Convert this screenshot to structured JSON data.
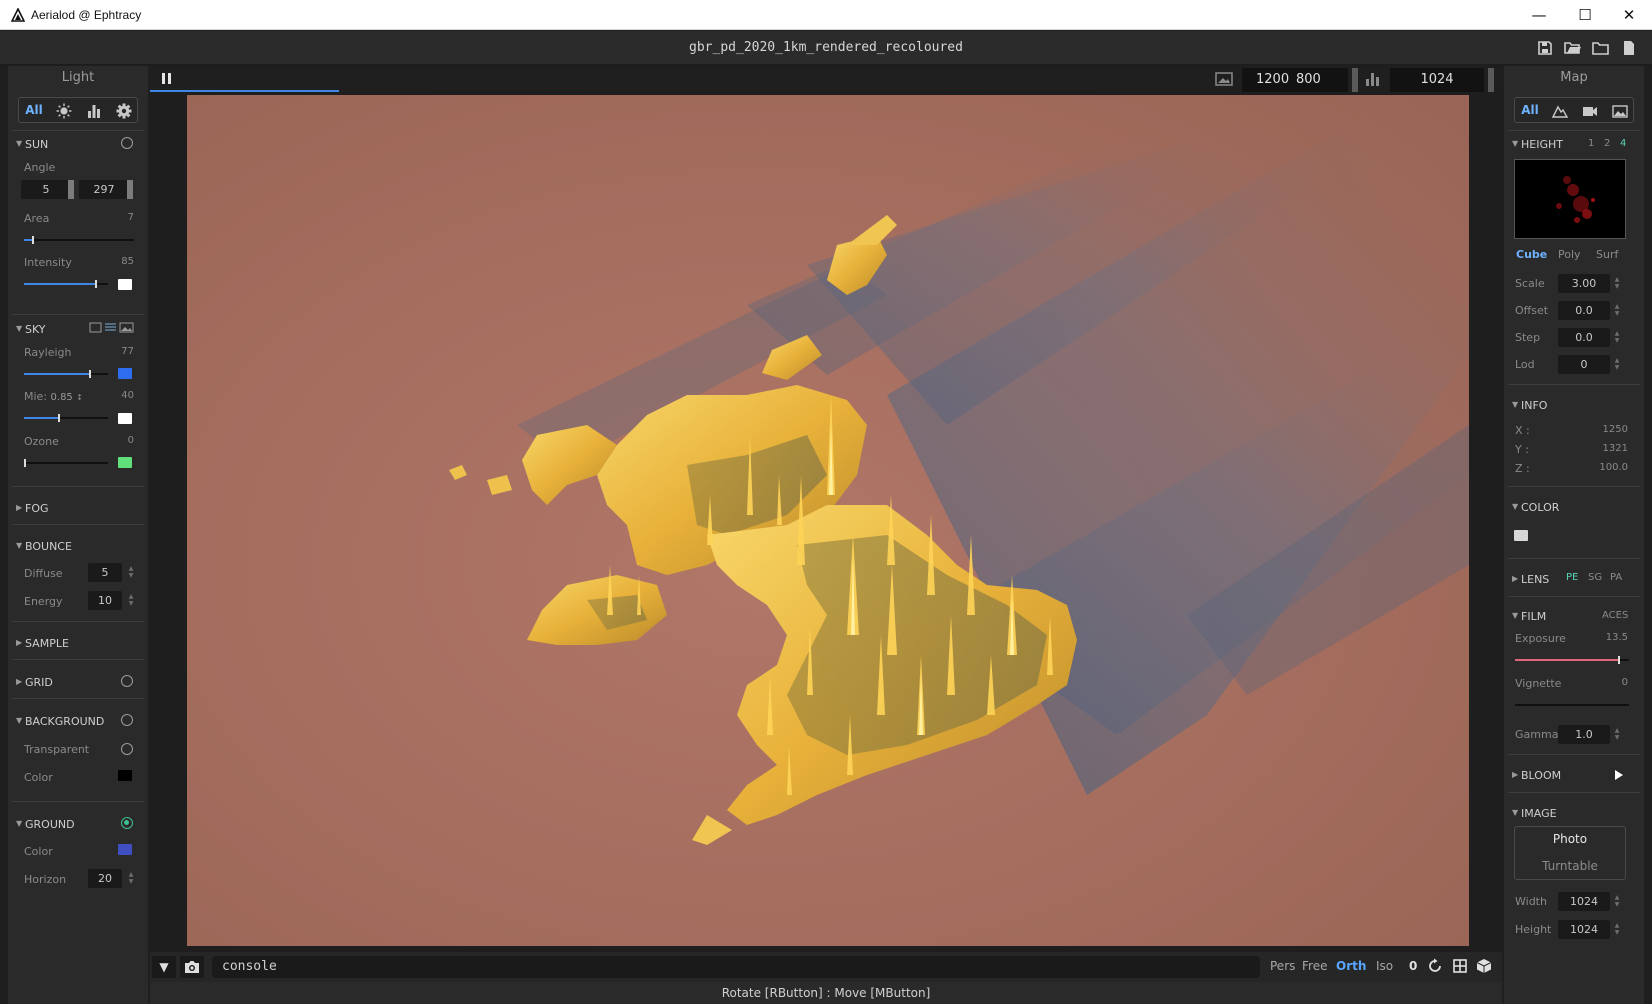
{
  "window": {
    "title": "Aerialod @ Ephtracy",
    "document_title": "gbr_pd_2020_1km_rendered_recoloured",
    "minimize_glyph": "—",
    "maximize_glyph": "☐",
    "close_glyph": "✕"
  },
  "left_panel": {
    "title": "Light",
    "tabs": [
      "All",
      "sun-icon",
      "bar-chart-icon",
      "gear-icon"
    ],
    "active_tab": "All",
    "sun": {
      "label": "SUN",
      "enabled": false,
      "angle_label": "Angle",
      "angle": [
        "5",
        "297"
      ],
      "area_label": "Area",
      "area": "7",
      "area_level": 0.07,
      "intensity_label": "Intensity",
      "intensity": "85",
      "intensity_level": 0.85,
      "intensity_color": "#ffffff"
    },
    "sky": {
      "label": "SKY",
      "rayleigh_label": "Rayleigh",
      "rayleigh": "77",
      "rayleigh_level": 0.77,
      "rayleigh_color": "#2e6cf0",
      "mie_label": "Mie:",
      "mie_factor": "0.85",
      "mie": "40",
      "mie_level": 0.4,
      "mie_color": "#ffffff",
      "ozone_label": "Ozone",
      "ozone": "0",
      "ozone_level": 0.0,
      "ozone_color": "#5fe07a"
    },
    "fog": {
      "label": "FOG"
    },
    "bounce": {
      "label": "BOUNCE",
      "diffuse_label": "Diffuse",
      "diffuse": "5",
      "energy_label": "Energy",
      "energy": "10"
    },
    "sample": {
      "label": "SAMPLE"
    },
    "grid": {
      "label": "GRID",
      "enabled": false
    },
    "background": {
      "label": "BACKGROUND",
      "enabled": false,
      "transparent_label": "Transparent",
      "transparent": false,
      "color_label": "Color",
      "color": "#000000"
    },
    "ground": {
      "label": "GROUND",
      "enabled": true,
      "color_label": "Color",
      "color": "#3f4fc2",
      "horizon_label": "Horizon",
      "horizon": "20"
    }
  },
  "toolbar": {
    "width": "1200",
    "height": "800",
    "samples": "1024",
    "progress": 0.14
  },
  "right_panel": {
    "title": "Map",
    "tabs": [
      "All",
      "terrain-icon",
      "camera-icon",
      "image-icon"
    ],
    "active_tab": "All",
    "height": {
      "label": "HEIGHT",
      "lod_options": [
        "1",
        "2",
        "4"
      ],
      "lod_selected": "4",
      "modes": [
        "Cube",
        "Poly",
        "Surf"
      ],
      "mode_selected": "Cube",
      "scale_label": "Scale",
      "scale": "3.00",
      "offset_label": "Offset",
      "offset": "0.0",
      "step_label": "Step",
      "step": "0.0",
      "lod_label": "Lod",
      "lod": "0"
    },
    "info": {
      "label": "INFO",
      "x_label": "X :",
      "x": "1250",
      "y_label": "Y :",
      "y": "1321",
      "z_label": "Z :",
      "z": "100.0"
    },
    "color": {
      "label": "COLOR",
      "swatch": "#d8d8d8"
    },
    "lens": {
      "label": "LENS",
      "options": [
        "PE",
        "SG",
        "PA"
      ],
      "selected": "PE"
    },
    "film": {
      "label": "FILM",
      "tonemap": "ACES",
      "exposure_label": "Exposure",
      "exposure": "13.5",
      "exposure_level": 0.9,
      "exposure_color": "#e0667a",
      "vignette_label": "Vignette",
      "vignette": "0",
      "vignette_level": 0.0,
      "gamma_label": "Gamma",
      "gamma": "1.0"
    },
    "bloom": {
      "label": "BLOOM"
    },
    "image": {
      "label": "IMAGE",
      "photo": "Photo",
      "turntable": "Turntable",
      "width_label": "Width",
      "width": "1024",
      "height_label": "Height",
      "height": "1024"
    }
  },
  "console": {
    "placeholder": "console",
    "views": [
      "Pers",
      "Free",
      "Orth",
      "Iso"
    ],
    "active_view": "Orth",
    "rotation": "0"
  },
  "status": "Rotate [RButton] : Move [MButton]"
}
